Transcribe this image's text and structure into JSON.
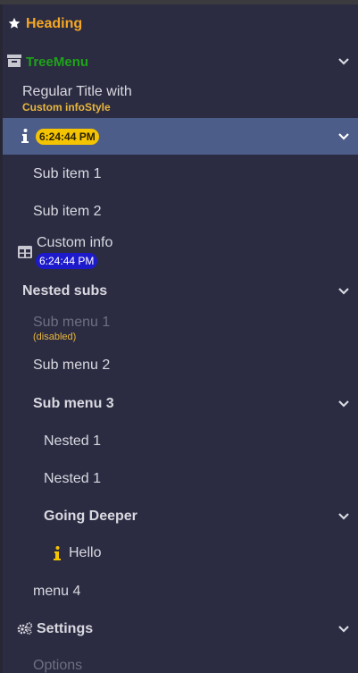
{
  "menu": {
    "heading": {
      "label": "Heading",
      "icon": "star-icon"
    },
    "tree_menu": {
      "label": "TreeMenu",
      "icon": "archive-icon"
    },
    "regular": {
      "title": "Regular Title with",
      "info": "Custom infoStyle"
    },
    "active_item": {
      "icon": "info-icon",
      "time": "6:24:44 PM"
    },
    "sub_item_1": "Sub item 1",
    "sub_item_2": "Sub item 2",
    "custom_info": {
      "label": "Custom info",
      "time": "6:24:44 PM",
      "icon": "table-icon"
    },
    "nested_subs": "Nested subs",
    "sub_menu_1": {
      "label": "Sub menu 1",
      "note": "(disabled)"
    },
    "sub_menu_2": "Sub menu 2",
    "sub_menu_3": "Sub menu 3",
    "nested_1a": "Nested 1",
    "nested_1b": "Nested 1",
    "going_deeper": "Going Deeper",
    "hello": {
      "label": "Hello",
      "icon": "info-icon"
    },
    "menu_4": "menu 4",
    "settings": {
      "label": "Settings",
      "icon": "gears-icon"
    },
    "options": "Options"
  },
  "colors": {
    "background": "#2b2c42",
    "active_row": "#4d5d8a",
    "heading": "#f5a623",
    "tree_menu": "#1fa319",
    "badge_yellow": "#f5c400",
    "badge_blue": "#1d1acb"
  }
}
